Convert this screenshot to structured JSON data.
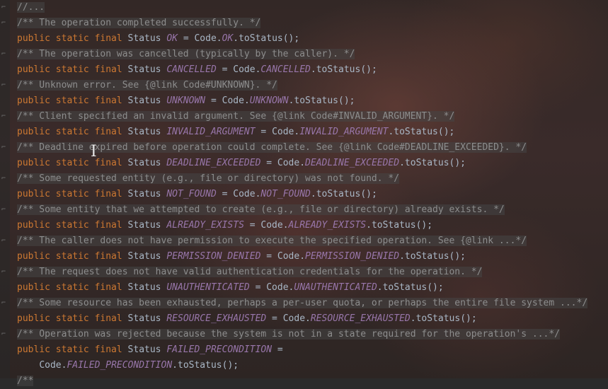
{
  "lines": [
    {
      "kind": "comment",
      "text": "//..."
    },
    {
      "kind": "comment",
      "text": "/** The operation completed successfully. */"
    },
    {
      "kind": "decl",
      "kw": "public static final",
      "type": "Status",
      "name": "OK",
      "rhs_class": "Code",
      "rhs_const": "OK",
      "rhs_tail": ".toStatus();"
    },
    {
      "kind": "comment",
      "text": "/** The operation was cancelled (typically by the caller). */"
    },
    {
      "kind": "decl",
      "kw": "public static final",
      "type": "Status",
      "name": "CANCELLED",
      "rhs_class": "Code",
      "rhs_const": "CANCELLED",
      "rhs_tail": ".toStatus();"
    },
    {
      "kind": "comment",
      "text": "/** Unknown error. See {@link Code#UNKNOWN}. */"
    },
    {
      "kind": "decl",
      "kw": "public static final",
      "type": "Status",
      "name": "UNKNOWN",
      "rhs_class": "Code",
      "rhs_const": "UNKNOWN",
      "rhs_tail": ".toStatus();"
    },
    {
      "kind": "comment",
      "text": "/** Client specified an invalid argument. See {@link Code#INVALID_ARGUMENT}. */"
    },
    {
      "kind": "decl",
      "kw": "public static final",
      "type": "Status",
      "name": "INVALID_ARGUMENT",
      "rhs_class": "Code",
      "rhs_const": "INVALID_ARGUMENT",
      "rhs_tail": ".toStatus();"
    },
    {
      "kind": "comment",
      "text": "/** Deadline expired before operation could complete. See {@link Code#DEADLINE_EXCEEDED}. */"
    },
    {
      "kind": "decl",
      "kw": "public static final",
      "type": "Status",
      "name": "DEADLINE_EXCEEDED",
      "rhs_class": "Code",
      "rhs_const": "DEADLINE_EXCEEDED",
      "rhs_tail": ".toStatus();"
    },
    {
      "kind": "comment",
      "text": "/** Some requested entity (e.g., file or directory) was not found. */"
    },
    {
      "kind": "decl",
      "kw": "public static final",
      "type": "Status",
      "name": "NOT_FOUND",
      "rhs_class": "Code",
      "rhs_const": "NOT_FOUND",
      "rhs_tail": ".toStatus();"
    },
    {
      "kind": "comment",
      "text": "/** Some entity that we attempted to create (e.g., file or directory) already exists. */"
    },
    {
      "kind": "decl",
      "kw": "public static final",
      "type": "Status",
      "name": "ALREADY_EXISTS",
      "rhs_class": "Code",
      "rhs_const": "ALREADY_EXISTS",
      "rhs_tail": ".toStatus();"
    },
    {
      "kind": "comment",
      "text": "/** The caller does not have permission to execute the specified operation. See {@link ...*/"
    },
    {
      "kind": "decl",
      "kw": "public static final",
      "type": "Status",
      "name": "PERMISSION_DENIED",
      "rhs_class": "Code",
      "rhs_const": "PERMISSION_DENIED",
      "rhs_tail": ".toStatus();"
    },
    {
      "kind": "comment",
      "text": "/** The request does not have valid authentication credentials for the operation. */"
    },
    {
      "kind": "decl",
      "kw": "public static final",
      "type": "Status",
      "name": "UNAUTHENTICATED",
      "rhs_class": "Code",
      "rhs_const": "UNAUTHENTICATED",
      "rhs_tail": ".toStatus();"
    },
    {
      "kind": "comment",
      "text": "/** Some resource has been exhausted, perhaps a per-user quota, or perhaps the entire file system ...*/"
    },
    {
      "kind": "decl",
      "kw": "public static final",
      "type": "Status",
      "name": "RESOURCE_EXHAUSTED",
      "rhs_class": "Code",
      "rhs_const": "RESOURCE_EXHAUSTED",
      "rhs_tail": ".toStatus();"
    },
    {
      "kind": "comment",
      "text": "/** Operation was rejected because the system is not in a state required for the operation's ...*/"
    },
    {
      "kind": "decl-split",
      "kw": "public static final",
      "type": "Status",
      "name": "FAILED_PRECONDITION"
    },
    {
      "kind": "cont",
      "rhs_class": "Code",
      "rhs_const": "FAILED_PRECONDITION",
      "rhs_tail": ".toStatus();"
    },
    {
      "kind": "comment",
      "text": "/**"
    }
  ],
  "cursor_glyph": "I",
  "fold_glyph": "⌐"
}
